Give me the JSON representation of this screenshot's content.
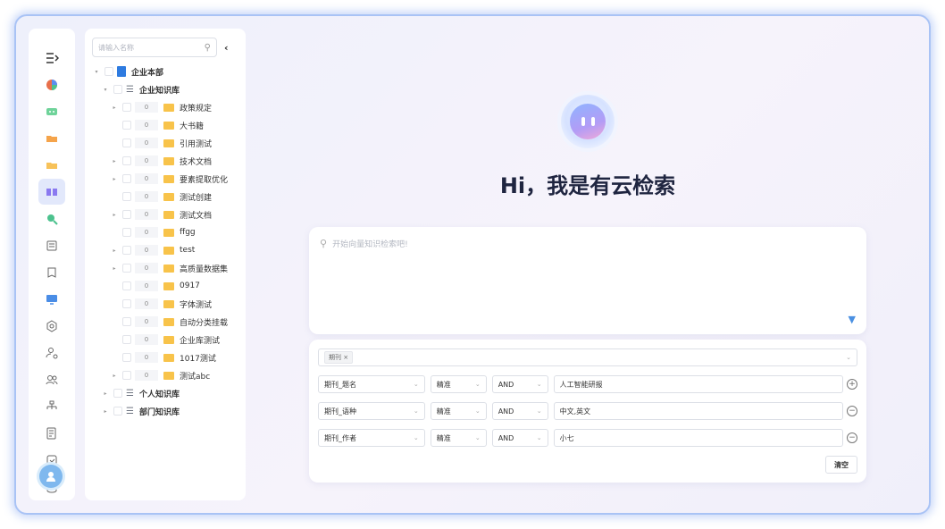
{
  "rail": {
    "icons": [
      "menu-expand-icon",
      "pie-chart-icon",
      "chat-icon",
      "folder-open-icon",
      "folder-icon",
      "book-open-icon",
      "search-shield-icon",
      "list-icon",
      "document-icon",
      "monitor-icon",
      "settings-hex-icon",
      "user-settings-icon",
      "users-icon",
      "org-chart-icon",
      "report-icon",
      "calendar-check-icon",
      "database-icon"
    ]
  },
  "tree": {
    "search_placeholder": "请输入名称",
    "root": "企业本部",
    "kb": "企业知识库",
    "folders": [
      {
        "count": "0",
        "name": "政策规定",
        "expandable": true
      },
      {
        "count": "0",
        "name": "大书籍",
        "expandable": false
      },
      {
        "count": "0",
        "name": "引用测试",
        "expandable": false
      },
      {
        "count": "0",
        "name": "技术文档",
        "expandable": true
      },
      {
        "count": "0",
        "name": "要素提取优化",
        "expandable": true
      },
      {
        "count": "0",
        "name": "测试创建",
        "expandable": false
      },
      {
        "count": "0",
        "name": "测试文档",
        "expandable": true
      },
      {
        "count": "0",
        "name": "ffgg",
        "expandable": false
      },
      {
        "count": "0",
        "name": "test",
        "expandable": true
      },
      {
        "count": "0",
        "name": "高质量数据集",
        "expandable": true
      },
      {
        "count": "0",
        "name": "0917",
        "expandable": false
      },
      {
        "count": "0",
        "name": "字体测试",
        "expandable": false
      },
      {
        "count": "0",
        "name": "自动分类挂载",
        "expandable": false
      },
      {
        "count": "0",
        "name": "企业库测试",
        "expandable": false
      },
      {
        "count": "0",
        "name": "1017测试",
        "expandable": false
      },
      {
        "count": "0",
        "name": "测试abc",
        "expandable": true
      }
    ],
    "personal": "个人知识库",
    "dept": "部门知识库"
  },
  "hero": {
    "title": "Hi，我是有云检索"
  },
  "query": {
    "placeholder": "开始向量知识检索吧!"
  },
  "filter": {
    "tag": "期刊",
    "tag_close": "×",
    "rules": [
      {
        "field": "期刊_题名",
        "match": "精准",
        "logic": "AND",
        "value": "人工智能研报",
        "action": "+"
      },
      {
        "field": "期刊_语种",
        "match": "精准",
        "logic": "AND",
        "value": "中文,英文",
        "action": "−"
      },
      {
        "field": "期刊_作者",
        "match": "精准",
        "logic": "AND",
        "value": "小七",
        "action": "−"
      }
    ],
    "clear": "清空"
  }
}
